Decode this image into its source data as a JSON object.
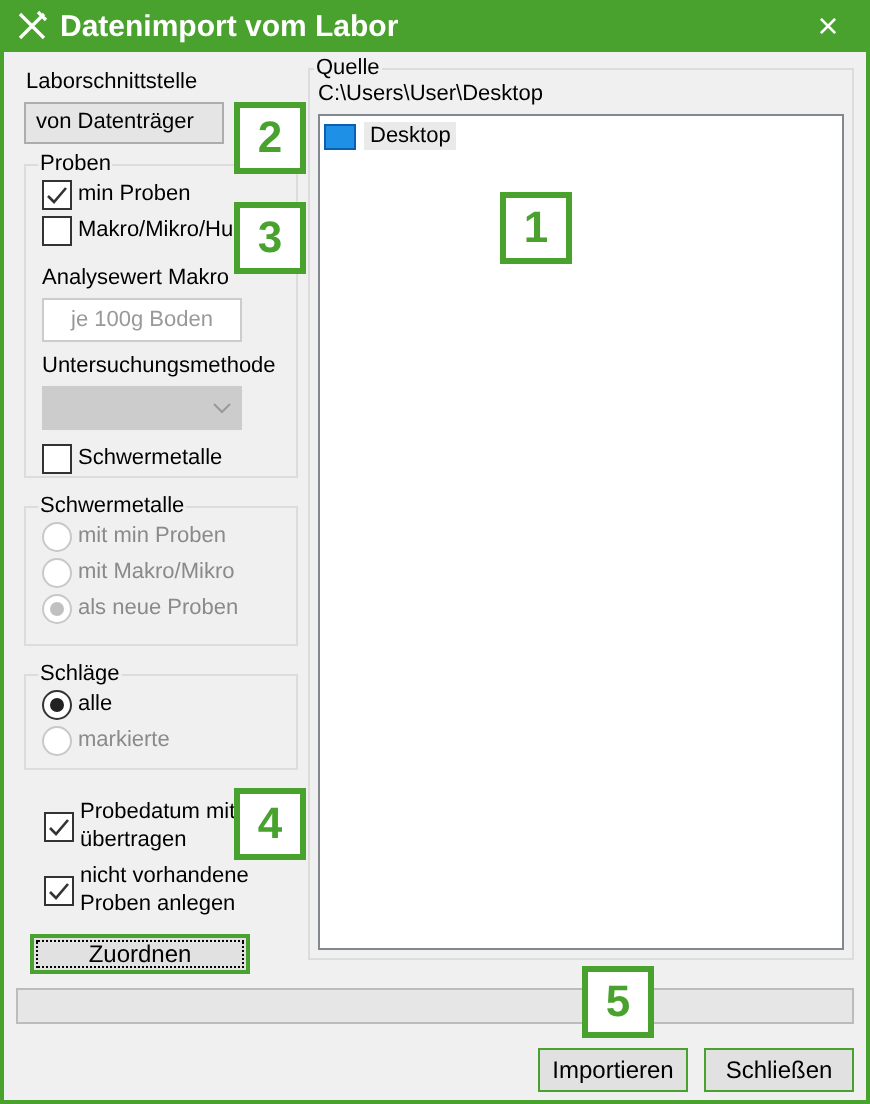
{
  "window": {
    "title": "Datenimport vom Labor",
    "close": "×"
  },
  "interface": {
    "label": "Laborschnittstelle",
    "value": "von Datenträger"
  },
  "proben": {
    "title": "Proben",
    "checks": [
      {
        "label": "min Proben",
        "checked": true
      },
      {
        "label": "Makro/Mikro/Hu",
        "checked": false
      }
    ],
    "analyse_label": "Analysewert Makro",
    "analyse_placeholder": "je 100g Boden",
    "method_label": "Untersuchungsmethode",
    "method_disabled": true,
    "heavy": {
      "label": "Schwermetalle",
      "checked": false
    }
  },
  "schwermetalle": {
    "title": "Schwermetalle",
    "options": [
      {
        "label": "mit min Proben",
        "selected": false,
        "disabled": true
      },
      {
        "label": "mit Makro/Mikro",
        "selected": false,
        "disabled": true
      },
      {
        "label": "als neue Proben",
        "selected": true,
        "disabled": true
      }
    ]
  },
  "schlaege": {
    "title": "Schläge",
    "options": [
      {
        "label": "alle",
        "selected": true,
        "disabled": false
      },
      {
        "label": "markierte",
        "selected": false,
        "disabled": true
      }
    ]
  },
  "options": [
    {
      "label": "Probedatum mit übertragen",
      "checked": true
    },
    {
      "label": "nicht vorhandene Proben anlegen",
      "checked": true
    }
  ],
  "assign_button": "Zuordnen",
  "source": {
    "title": "Quelle",
    "path": "C:\\Users\\User\\Desktop",
    "tree": [
      {
        "label": "Desktop",
        "selected": true
      }
    ]
  },
  "buttons": [
    "Importieren",
    "Schließen"
  ],
  "callouts": [
    {
      "label": "1"
    },
    {
      "label": "2"
    },
    {
      "label": "3"
    },
    {
      "label": "4"
    },
    {
      "label": "5"
    }
  ]
}
